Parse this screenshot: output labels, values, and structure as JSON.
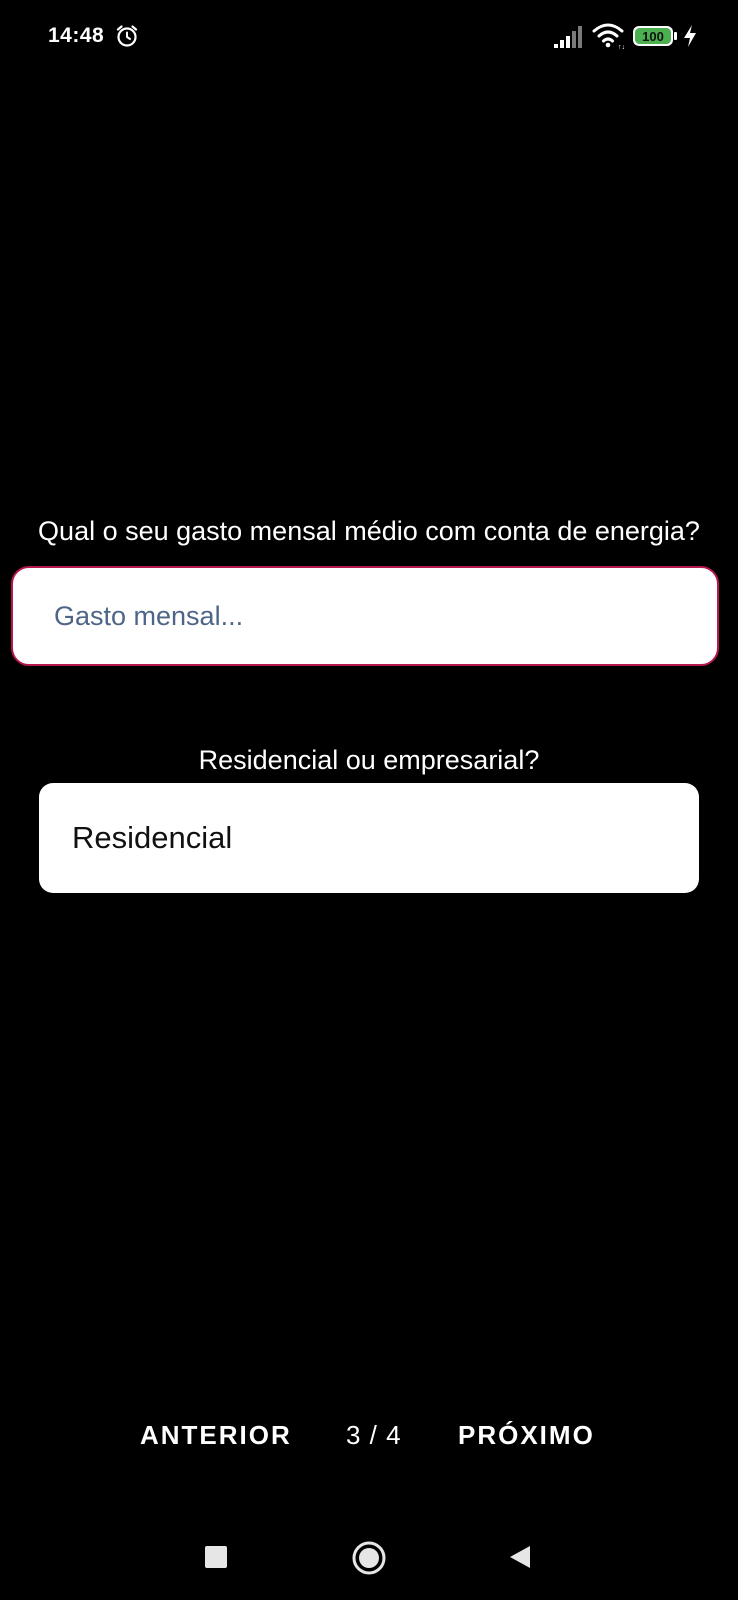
{
  "status_bar": {
    "time": "14:48",
    "battery": "100",
    "icons": [
      "alarm-icon",
      "signal-icon",
      "wifi-icon",
      "battery-icon",
      "charge-icon"
    ]
  },
  "form": {
    "question_spend": "Qual o seu gasto mensal médio com conta de energia?",
    "spend_input": {
      "value": "",
      "placeholder": "Gasto mensal..."
    },
    "question_type": "Residencial ou empresarial?",
    "type_select": {
      "selected": "Residencial"
    }
  },
  "pager": {
    "prev_label": "ANTERIOR",
    "counter": "3 / 4",
    "next_label": "PRÓXIMO"
  },
  "nav_bar": {
    "icons": [
      "recents-icon",
      "home-icon",
      "back-icon"
    ]
  },
  "colors": {
    "background": "#000000",
    "input_border": "#b5174e",
    "placeholder": "#4e6587",
    "battery_fill": "#4caf50"
  }
}
